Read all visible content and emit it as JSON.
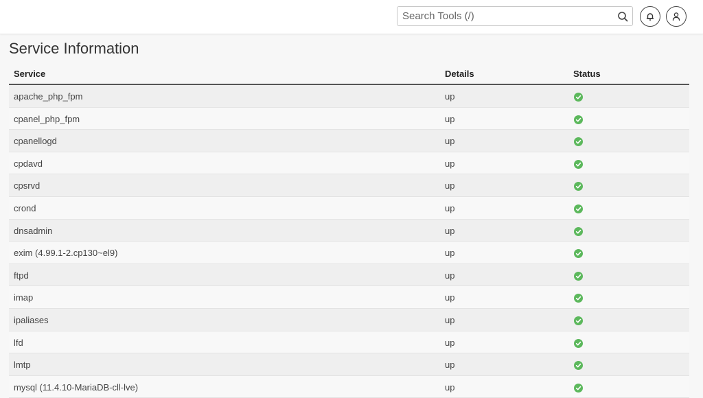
{
  "header": {
    "search_placeholder": "Search Tools (/)"
  },
  "page": {
    "title": "Service Information"
  },
  "table": {
    "columns": [
      "Service",
      "Details",
      "Status"
    ],
    "status_color": "#5cb85c",
    "rows": [
      {
        "service": "apache_php_fpm",
        "details": "up",
        "status": "ok"
      },
      {
        "service": "cpanel_php_fpm",
        "details": "up",
        "status": "ok"
      },
      {
        "service": "cpanellogd",
        "details": "up",
        "status": "ok"
      },
      {
        "service": "cpdavd",
        "details": "up",
        "status": "ok"
      },
      {
        "service": "cpsrvd",
        "details": "up",
        "status": "ok"
      },
      {
        "service": "crond",
        "details": "up",
        "status": "ok"
      },
      {
        "service": "dnsadmin",
        "details": "up",
        "status": "ok"
      },
      {
        "service": "exim (4.99.1-2.cp130~el9)",
        "details": "up",
        "status": "ok"
      },
      {
        "service": "ftpd",
        "details": "up",
        "status": "ok"
      },
      {
        "service": "imap",
        "details": "up",
        "status": "ok"
      },
      {
        "service": "ipaliases",
        "details": "up",
        "status": "ok"
      },
      {
        "service": "lfd",
        "details": "up",
        "status": "ok"
      },
      {
        "service": "lmtp",
        "details": "up",
        "status": "ok"
      },
      {
        "service": "mysql (11.4.10-MariaDB-cll-lve)",
        "details": "up",
        "status": "ok"
      }
    ]
  }
}
